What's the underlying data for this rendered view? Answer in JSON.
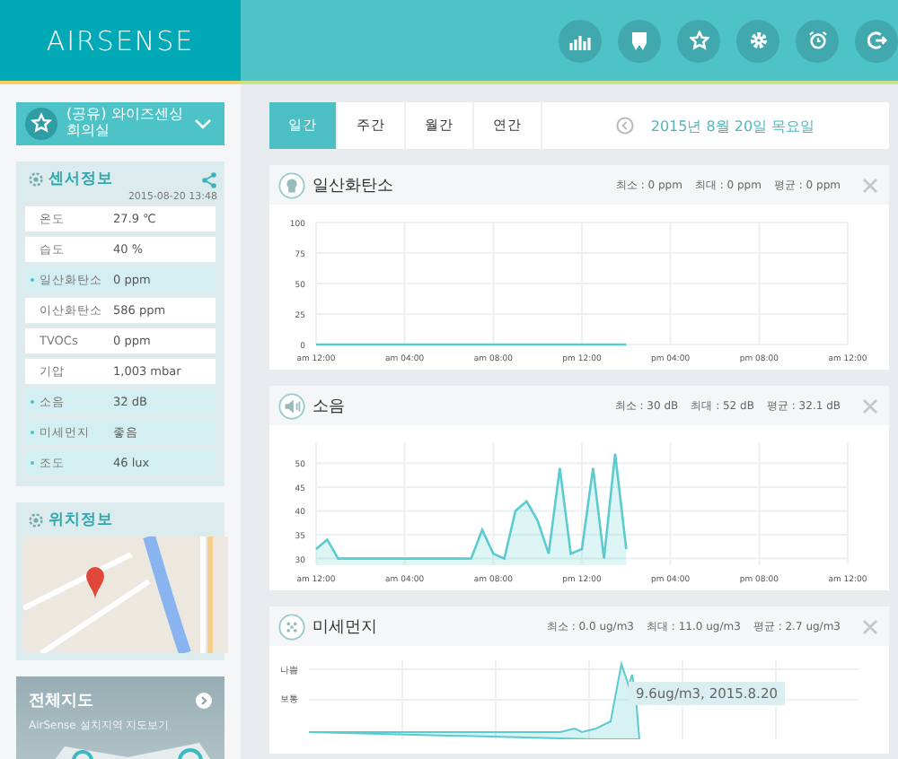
{
  "header": {
    "logo": "AIRSENSE"
  },
  "sidebar": {
    "station": {
      "name": "(공유) 와이즈센싱회의실"
    },
    "sensor_info": {
      "title": "센서정보",
      "timestamp": "2015-08-20 13:48",
      "rows": [
        {
          "label": "온도",
          "value": "27.9 ℃",
          "selected": false
        },
        {
          "label": "습도",
          "value": "40 %",
          "selected": false
        },
        {
          "label": "일산화탄소",
          "value": "0 ppm",
          "selected": true
        },
        {
          "label": "이산화탄소",
          "value": "586 ppm",
          "selected": false
        },
        {
          "label": "TVOCs",
          "value": "0 ppm",
          "selected": false
        },
        {
          "label": "기압",
          "value": "1,003 mbar",
          "selected": false
        },
        {
          "label": "소음",
          "value": "32 dB",
          "selected": true
        },
        {
          "label": "미세먼지",
          "value": "좋음",
          "selected": true
        },
        {
          "label": "조도",
          "value": "46 lux",
          "selected": true
        }
      ]
    },
    "location": {
      "title": "위치정보"
    },
    "full_map": {
      "title": "전체지도",
      "subtitle": "AirSense 설치지역 지도보기"
    }
  },
  "period_tabs": [
    {
      "label": "일간",
      "selected": true
    },
    {
      "label": "주간",
      "selected": false
    },
    {
      "label": "월간",
      "selected": false
    },
    {
      "label": "연간",
      "selected": false
    }
  ],
  "date": "2015년 8월 20일 목요일",
  "charts": [
    {
      "kind": "co",
      "title": "일산화탄소",
      "stats": [
        "최소 : 0 ppm",
        "최대 : 0 ppm",
        "평균 : 0 ppm"
      ],
      "chart_data": {
        "type": "line",
        "categories": [
          "am 12:00",
          null,
          null,
          null,
          null,
          null,
          null,
          null,
          "am 04:00",
          null,
          null,
          null,
          null,
          null,
          null,
          null,
          "am 08:00",
          null,
          null,
          null,
          null,
          null,
          null,
          null,
          "pm 12:00",
          null,
          null,
          null,
          null,
          null,
          null,
          null,
          "pm 04:00",
          null,
          null,
          null,
          null,
          null,
          null,
          null,
          "pm 08:00",
          null,
          null,
          null,
          null,
          null,
          null,
          null,
          "am 12:00"
        ],
        "series": [
          {
            "color": "#5ccbd0",
            "values": [
              0,
              0,
              0,
              0,
              0,
              0,
              0,
              0,
              0,
              0,
              0,
              0,
              0,
              0,
              0,
              0,
              0,
              0,
              0,
              0,
              0,
              0,
              0,
              0,
              0,
              0,
              0,
              0,
              0,
              null,
              null,
              null,
              null,
              null,
              null,
              null,
              null,
              null,
              null,
              null,
              null,
              null,
              null,
              null,
              null,
              null,
              null,
              null,
              null
            ]
          }
        ],
        "ylim": [
          0,
          100
        ],
        "yticks": [
          0,
          25,
          50,
          75,
          100
        ],
        "grid": true
      }
    },
    {
      "kind": "noise",
      "title": "소음",
      "stats": [
        "최소 : 30 dB",
        "최대 : 52 dB",
        "평균 : 32.1 dB"
      ],
      "chart_data": {
        "type": "area",
        "categories": [
          "am 12:00",
          null,
          null,
          null,
          null,
          null,
          null,
          null,
          "am 04:00",
          null,
          null,
          null,
          null,
          null,
          null,
          null,
          "am 08:00",
          null,
          null,
          null,
          null,
          null,
          null,
          null,
          "pm 12:00",
          null,
          null,
          null,
          null,
          null,
          null,
          null,
          "pm 04:00",
          null,
          null,
          null,
          null,
          null,
          null,
          null,
          "pm 08:00",
          null,
          null,
          null,
          null,
          null,
          null,
          null,
          "am 12:00"
        ],
        "series": [
          {
            "color": "#5ccbd0",
            "values": [
              32,
              34,
              30,
              30,
              30,
              30,
              30,
              30,
              30,
              30,
              30,
              30,
              30,
              30,
              30,
              36,
              31,
              30,
              40,
              42,
              38,
              31,
              49,
              31,
              32,
              49,
              30,
              52,
              32,
              null,
              null,
              null,
              null,
              null,
              null,
              null,
              null,
              null,
              null,
              null,
              null,
              null,
              null,
              null,
              null,
              null,
              null,
              null,
              null
            ]
          }
        ],
        "ylim": [
          28.6,
          54.2
        ],
        "yticks": [
          30,
          35,
          40,
          45,
          50
        ],
        "grid": true
      }
    },
    {
      "kind": "dust",
      "title": "미세먼지",
      "stats": [
        "최소 : 0.0 ug/m3",
        "최대 : 11.0 ug/m3",
        "평균 : 2.7 ug/m3"
      ],
      "y_labels": [
        "나쁨",
        "보통"
      ],
      "tooltip": "9.6ug/m3, 2015.8.20"
    }
  ]
}
